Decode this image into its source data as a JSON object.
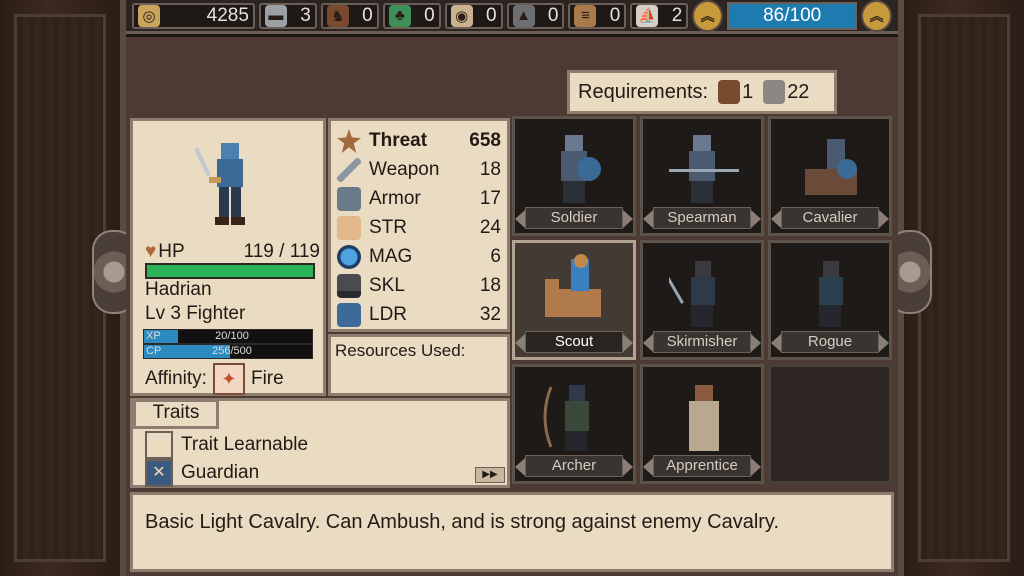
{
  "topbar": {
    "resources": [
      {
        "icon": "coins-icon",
        "value": "4285"
      },
      {
        "icon": "iron-ingot-icon",
        "value": "3"
      },
      {
        "icon": "horse-icon",
        "value": "0"
      },
      {
        "icon": "herb-icon",
        "value": "0"
      },
      {
        "icon": "shield-icon",
        "value": "0"
      },
      {
        "icon": "anvil-icon",
        "value": "0"
      },
      {
        "icon": "scrolls-icon",
        "value": "0"
      },
      {
        "icon": "ship-icon",
        "value": "2"
      }
    ],
    "supply": "86/100"
  },
  "requirements": {
    "label": "Requirements:",
    "horse_count": "1",
    "boot_count": "22"
  },
  "unit": {
    "hp_label": "HP",
    "hp_value": "119 / 119",
    "hp_fraction": 1.0,
    "name": "Hadrian",
    "level": "Lv 3 Fighter",
    "xp_label": "XP",
    "xp_value": "20/100",
    "xp_fraction": 0.2,
    "cp_label": "CP",
    "cp_value": "256/500",
    "cp_fraction": 0.512,
    "affinity_label": "Affinity:",
    "affinity_value": "Fire"
  },
  "stats": [
    {
      "label": "Threat",
      "value": "658",
      "icon": "star-icon",
      "bold": true
    },
    {
      "label": "Weapon",
      "value": "18",
      "icon": "sword-icon"
    },
    {
      "label": "Armor",
      "value": "17",
      "icon": "armor-icon"
    },
    {
      "label": "STR",
      "value": "24",
      "icon": "arm-icon"
    },
    {
      "label": "MAG",
      "value": "6",
      "icon": "orb-icon"
    },
    {
      "label": "SKL",
      "value": "18",
      "icon": "dagger-icon"
    },
    {
      "label": "LDR",
      "value": "32",
      "icon": "banner-icon"
    }
  ],
  "resources_used": {
    "label": "Resources Used:"
  },
  "traits": {
    "header": "Traits",
    "items": [
      {
        "label": "Trait Learnable",
        "icon": "empty-box-icon"
      },
      {
        "label": "Guardian",
        "icon": "guardian-icon"
      }
    ]
  },
  "classes": [
    {
      "name": "Soldier"
    },
    {
      "name": "Spearman"
    },
    {
      "name": "Cavalier"
    },
    {
      "name": "Scout",
      "selected": true
    },
    {
      "name": "Skirmisher"
    },
    {
      "name": "Rogue"
    },
    {
      "name": "Archer"
    },
    {
      "name": "Apprentice"
    }
  ],
  "description": "Basic Light Cavalry. Can Ambush, and is strong against enemy Cavalry."
}
